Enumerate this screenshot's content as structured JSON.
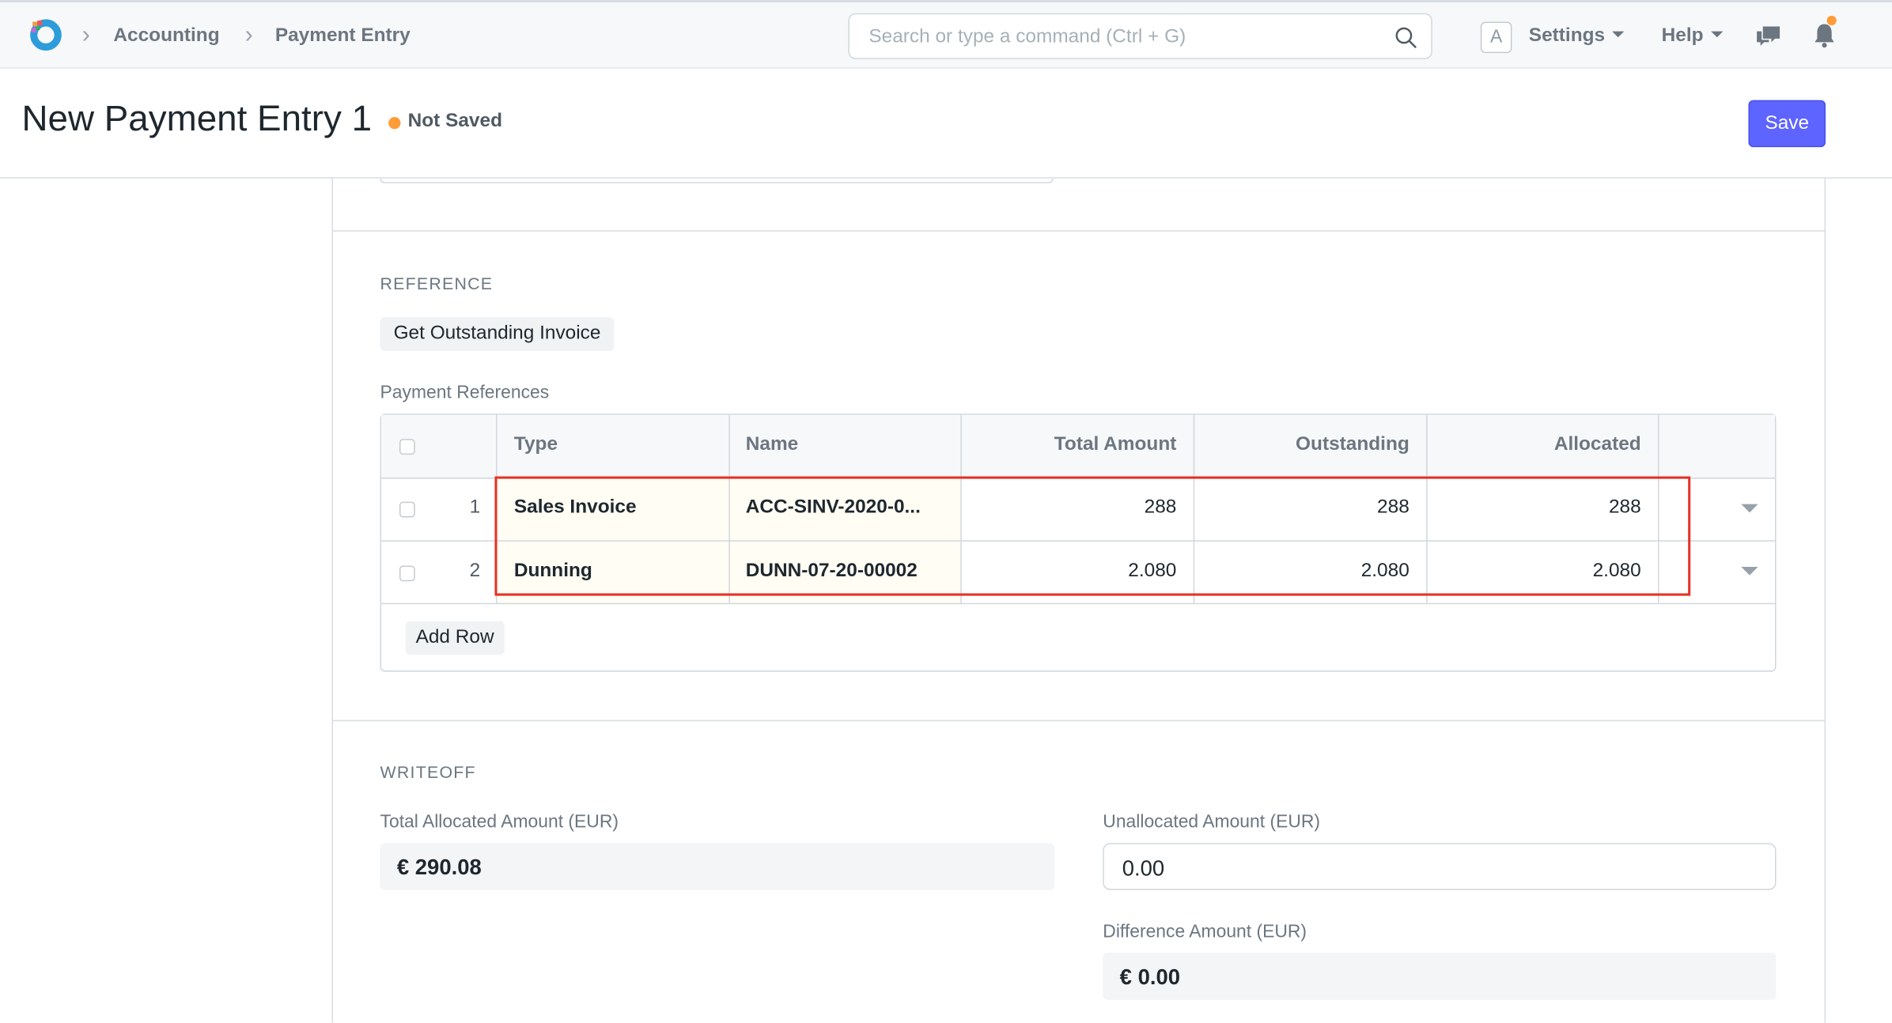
{
  "navbar": {
    "breadcrumbs": [
      "Accounting",
      "Payment Entry"
    ],
    "search_placeholder": "Search or type a command (Ctrl + G)",
    "avatar_letter": "A",
    "settings_label": "Settings",
    "help_label": "Help",
    "notification_color": "#ff9b38"
  },
  "page": {
    "title": "New Payment Entry 1",
    "status": "Not Saved",
    "save_label": "Save",
    "primary_color": "#5e64ff"
  },
  "reference": {
    "section_title": "REFERENCE",
    "get_outstanding_label": "Get Outstanding Invoice",
    "table_label": "Payment References",
    "columns": [
      "Type",
      "Name",
      "Total Amount",
      "Outstanding",
      "Allocated"
    ],
    "rows": [
      {
        "no": "1",
        "type": "Sales Invoice",
        "name": "ACC-SINV-2020-0...",
        "total": "288",
        "outstanding": "288",
        "allocated": "288"
      },
      {
        "no": "2",
        "type": "Dunning",
        "name": "DUNN-07-20-00002",
        "total": "2.080",
        "outstanding": "2.080",
        "allocated": "2.080"
      }
    ],
    "add_row_label": "Add Row",
    "highlight_color": "#e53125"
  },
  "writeoff": {
    "section_title": "WRITEOFF",
    "total_allocated_label": "Total Allocated Amount (EUR)",
    "total_allocated_value": "€ 290.08",
    "unallocated_label": "Unallocated Amount (EUR)",
    "unallocated_value": "0.00",
    "difference_label": "Difference Amount (EUR)",
    "difference_value": "€ 0.00"
  }
}
